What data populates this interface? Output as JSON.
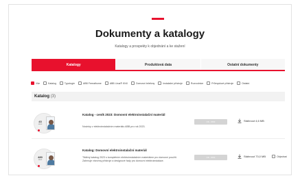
{
  "colors": {
    "accent": "#e8112d",
    "tab_inactive_bg": "#f7f7f7",
    "section_bg": "#f2f2f2"
  },
  "page": {
    "title": "Dokumenty a katalogy",
    "subtitle": "Katalogy a prospekty k objednání a ke stažení"
  },
  "tabs": [
    {
      "label": "Katalogy",
      "active": true
    },
    {
      "label": "Produktová data",
      "active": false
    },
    {
      "label": "Ostatní dokumenty",
      "active": false
    }
  ],
  "filters": [
    {
      "label": "Vše",
      "checked": true
    },
    {
      "label": "Katalog",
      "checked": false
    },
    {
      "label": "Typologie",
      "checked": false
    },
    {
      "label": "ABB Freeathome",
      "checked": false
    },
    {
      "label": "ABB i-bus® KNX",
      "checked": false
    },
    {
      "label": "Domovní telefony",
      "checked": false
    },
    {
      "label": "Instalační přístroje",
      "checked": false
    },
    {
      "label": "Rozvodnice",
      "checked": false
    },
    {
      "label": "Průmyslové přístroje",
      "checked": false
    },
    {
      "label": "Ostatní",
      "checked": false
    }
  ],
  "section": {
    "title": "Katalog",
    "count": "(3)"
  },
  "items": [
    {
      "thumb_number": "43",
      "thumb_caption": "stran",
      "title": "Katalog - ceník 2023: Domovní elektroinstalační materiál",
      "description": "Novinky v elektroinstalačním materiálu ABB pro rok 2023.",
      "language": "CS · PDF",
      "download_label": "Stáhnout 4,6 MB",
      "order_label": ""
    },
    {
      "thumb_number": "480",
      "thumb_caption": "stran",
      "title": "Katalog: Domovní elektroinstalační materiál",
      "description": "Tištěný katalog 2023 s kompletním elektroinstalačním materiálem pro domovní použití. Zahrnuje všechny přístroje a designové řady pro domovní elektroinstalace.",
      "language": "CS · PDF",
      "download_label": "Stáhnout 73,0 MB",
      "order_label": "Objednat"
    }
  ],
  "icons": {
    "download": "download-icon",
    "checkbox": "checkbox-icon"
  }
}
